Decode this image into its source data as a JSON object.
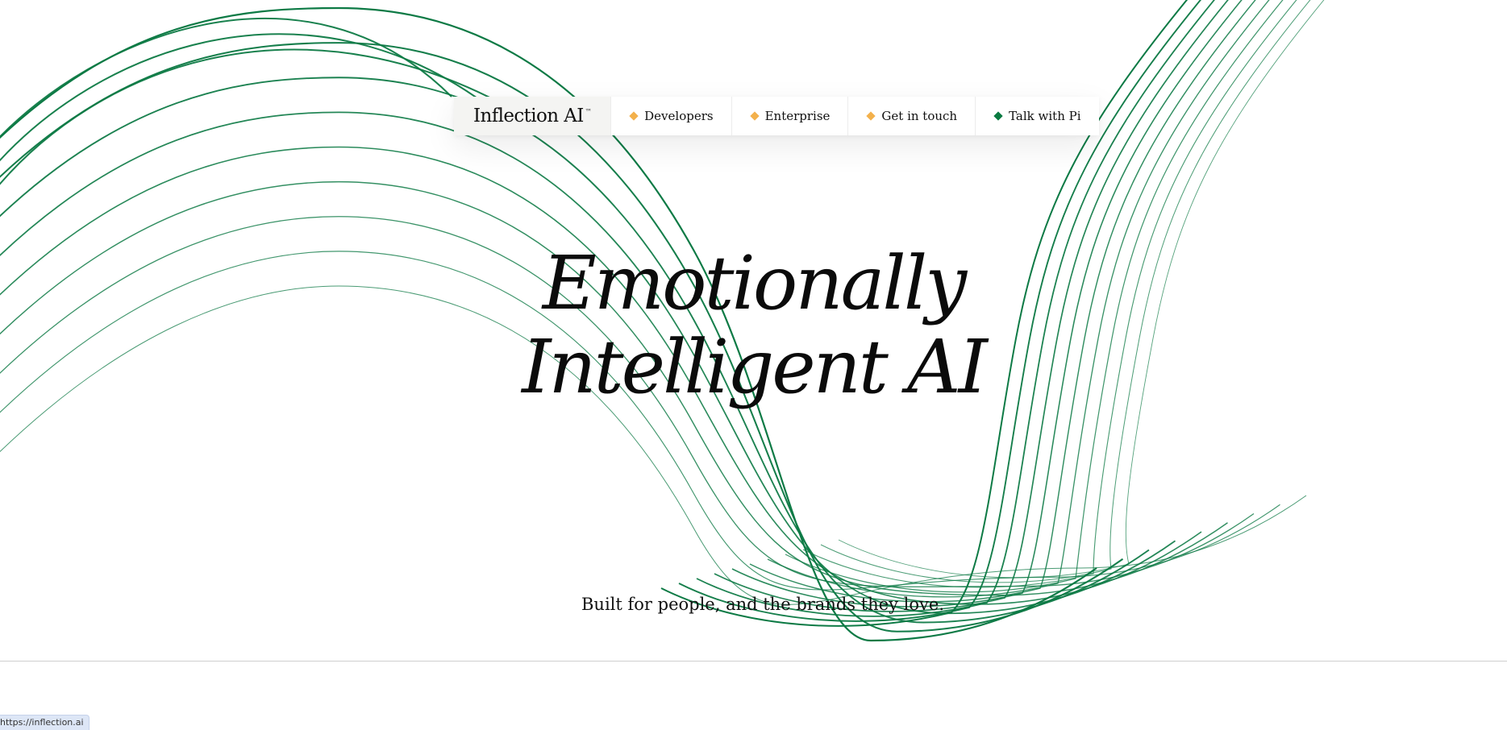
{
  "brand": {
    "name": "Inflection AI",
    "trademark": "™"
  },
  "nav": {
    "items": [
      {
        "label": "Developers",
        "icon": "diamond-icon",
        "color": "#f3b14c"
      },
      {
        "label": "Enterprise",
        "icon": "diamond-icon",
        "color": "#f3b14c"
      },
      {
        "label": "Get in touch",
        "icon": "diamond-icon",
        "color": "#f3b14c"
      },
      {
        "label": "Talk with Pi",
        "icon": "diamond-icon",
        "color": "#0a7a41"
      }
    ]
  },
  "hero": {
    "line1": "Emotionally",
    "line2": "Intelligent AI"
  },
  "tagline": "Built for people, and the brands they love.",
  "status_bar": {
    "url": "https://inflection.ai"
  },
  "colors": {
    "wave_stroke": "#0d7a45",
    "accent_orange": "#f3b14c",
    "accent_green": "#0a7a41",
    "background": "#ffffff"
  }
}
